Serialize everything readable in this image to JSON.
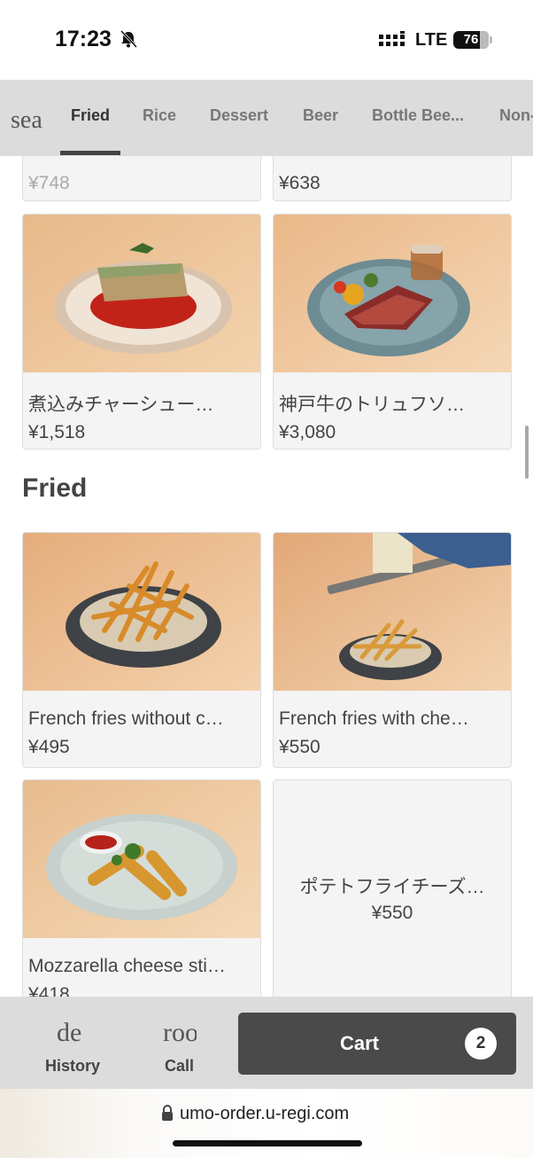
{
  "status_bar": {
    "time": "17:23",
    "network": "LTE",
    "battery": "76"
  },
  "tabs": {
    "search_stub": "sea",
    "items": [
      "Fried",
      "Rice",
      "Dessert",
      "Beer",
      "Bottle Bee...",
      "Non-"
    ],
    "active": "Fried"
  },
  "top_row": [
    {
      "price": "¥748"
    },
    {
      "price": "¥638"
    }
  ],
  "row1": [
    {
      "name": "煮込みチャーシュー…",
      "price": "¥1,518",
      "image": "braised-pork-dish"
    },
    {
      "name": "神戸牛のトリュフソ…",
      "price": "¥3,080",
      "image": "kobe-beef-dish"
    }
  ],
  "section_fried": {
    "title": "Fried"
  },
  "fried_row1": [
    {
      "name": "French fries without c…",
      "price": "¥495",
      "image": "french-fries-plain"
    },
    {
      "name": "French fries with che…",
      "price": "¥550",
      "image": "french-fries-cheese"
    }
  ],
  "fried_row2": [
    {
      "name": "Mozzarella cheese sti…",
      "price": "¥418",
      "image": "mozzarella-sticks"
    },
    {
      "name": "ポテトフライチーズ…",
      "price": "¥550"
    }
  ],
  "bottom_bar": {
    "history_icon": "de",
    "history_label": "History",
    "call_icon": "roo",
    "call_label": "Call",
    "cart_label": "Cart",
    "cart_count": "2"
  },
  "url_bar": {
    "url": "umo-order.u-regi.com"
  }
}
